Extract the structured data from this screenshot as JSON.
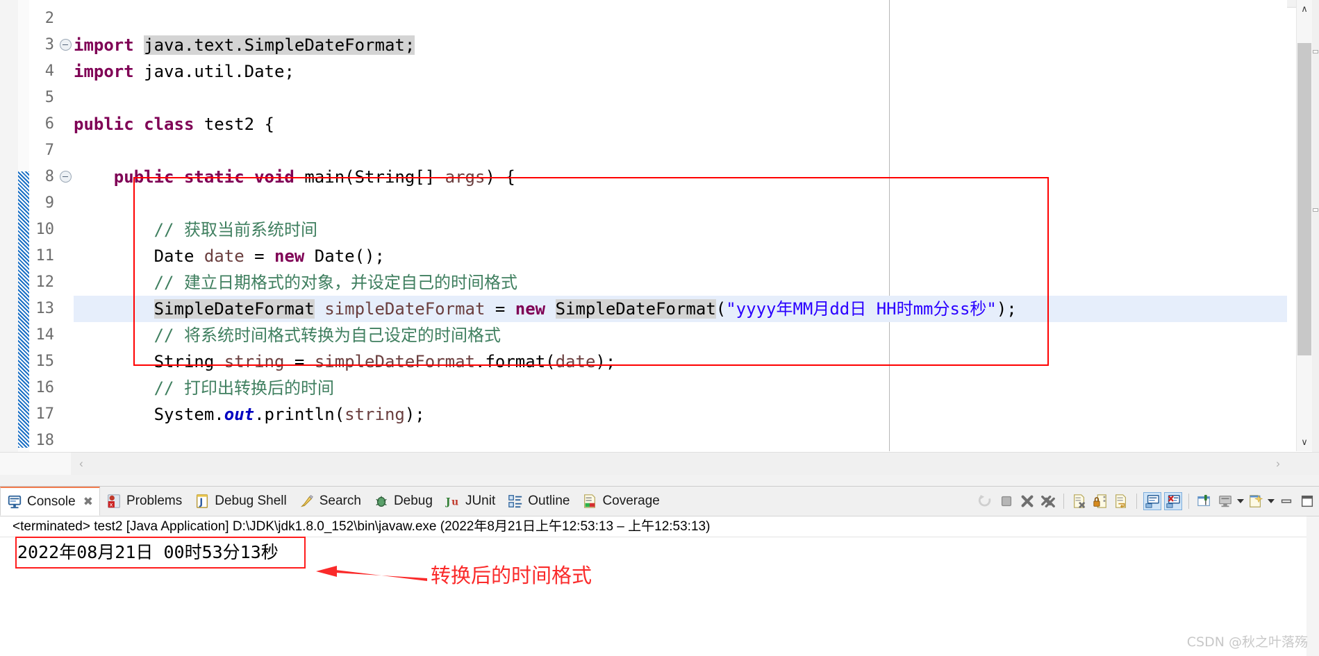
{
  "editor": {
    "first_line_number": 2,
    "lines": [
      {
        "num": "2",
        "fold": false,
        "highlight": false,
        "tokens": []
      },
      {
        "num": "3",
        "fold": true,
        "highlight": false,
        "tokens": [
          {
            "t": "import ",
            "c": "kw"
          },
          {
            "t": "java.text.SimpleDateFormat;",
            "c": "plain occ"
          }
        ]
      },
      {
        "num": "4",
        "fold": false,
        "highlight": false,
        "tokens": [
          {
            "t": "import ",
            "c": "kw"
          },
          {
            "t": "java.util.Date;",
            "c": "plain"
          }
        ]
      },
      {
        "num": "5",
        "fold": false,
        "highlight": false,
        "tokens": []
      },
      {
        "num": "6",
        "fold": false,
        "highlight": false,
        "tokens": [
          {
            "t": "public class ",
            "c": "kw"
          },
          {
            "t": "test2 {",
            "c": "plain"
          }
        ]
      },
      {
        "num": "7",
        "fold": false,
        "highlight": false,
        "tokens": []
      },
      {
        "num": "8",
        "fold": true,
        "highlight": false,
        "tokens": [
          {
            "t": "    ",
            "c": "plain"
          },
          {
            "t": "public static void ",
            "c": "kw"
          },
          {
            "t": "main(String[] ",
            "c": "plain"
          },
          {
            "t": "args",
            "c": "lvar"
          },
          {
            "t": ") {",
            "c": "plain"
          }
        ]
      },
      {
        "num": "9",
        "fold": false,
        "highlight": false,
        "tokens": []
      },
      {
        "num": "10",
        "fold": false,
        "highlight": false,
        "tokens": [
          {
            "t": "        // 获取当前系统时间",
            "c": "cmt"
          }
        ]
      },
      {
        "num": "11",
        "fold": false,
        "highlight": false,
        "tokens": [
          {
            "t": "        Date ",
            "c": "plain"
          },
          {
            "t": "date",
            "c": "lvar"
          },
          {
            "t": " = ",
            "c": "plain"
          },
          {
            "t": "new ",
            "c": "kw"
          },
          {
            "t": "Date();",
            "c": "plain"
          }
        ]
      },
      {
        "num": "12",
        "fold": false,
        "highlight": false,
        "tokens": [
          {
            "t": "        // 建立日期格式的对象，并设定自己的时间格式",
            "c": "cmt"
          }
        ]
      },
      {
        "num": "13",
        "fold": false,
        "highlight": true,
        "tokens": [
          {
            "t": "        ",
            "c": "plain"
          },
          {
            "t": "SimpleDateFormat",
            "c": "plain occ"
          },
          {
            "t": " ",
            "c": "plain"
          },
          {
            "t": "simpleDateFormat",
            "c": "lvar"
          },
          {
            "t": " = ",
            "c": "plain"
          },
          {
            "t": "new ",
            "c": "kw"
          },
          {
            "t": "SimpleDateFormat",
            "c": "plain occ"
          },
          {
            "t": "(",
            "c": "plain"
          },
          {
            "t": "\"yyyy年MM月dd日 HH时mm分ss秒\"",
            "c": "str"
          },
          {
            "t": ");",
            "c": "plain"
          }
        ]
      },
      {
        "num": "14",
        "fold": false,
        "highlight": false,
        "tokens": [
          {
            "t": "        // 将系统时间格式转换为自己设定的时间格式",
            "c": "cmt"
          }
        ]
      },
      {
        "num": "15",
        "fold": false,
        "highlight": false,
        "tokens": [
          {
            "t": "        String ",
            "c": "plain"
          },
          {
            "t": "string",
            "c": "lvar"
          },
          {
            "t": " = ",
            "c": "plain"
          },
          {
            "t": "simpleDateFormat",
            "c": "lvar"
          },
          {
            "t": ".format(",
            "c": "plain"
          },
          {
            "t": "date",
            "c": "lvar"
          },
          {
            "t": ");",
            "c": "plain"
          }
        ]
      },
      {
        "num": "16",
        "fold": false,
        "highlight": false,
        "tokens": [
          {
            "t": "        // 打印出转换后的时间",
            "c": "cmt"
          }
        ]
      },
      {
        "num": "17",
        "fold": false,
        "highlight": false,
        "tokens": [
          {
            "t": "        System.",
            "c": "plain"
          },
          {
            "t": "out",
            "c": "fld"
          },
          {
            "t": ".println(",
            "c": "plain"
          },
          {
            "t": "string",
            "c": "lvar"
          },
          {
            "t": ");",
            "c": "plain"
          }
        ]
      },
      {
        "num": "18",
        "fold": false,
        "highlight": false,
        "tokens": []
      }
    ],
    "scroll_left_label": "‹",
    "scroll_right_label": "›",
    "scroll_up_label": "∧",
    "scroll_down_label": "∨"
  },
  "colors": {
    "keyword": "#7f0055",
    "comment": "#3f7f5f",
    "string": "#2a00ff",
    "field": "#0000c0",
    "local_var": "#6a3e3e",
    "annotation_red": "#fa2a2a",
    "box_red": "#ff0000",
    "selection_row": "#e6eefb",
    "occurrence": "#d4d4d4",
    "change_bar_blue": "#1a6fc4",
    "tab_active_top": "#f27c4e"
  },
  "bottom_panel": {
    "tabs": [
      {
        "label": "Console",
        "icon": "console-icon",
        "active": true,
        "closeable": true
      },
      {
        "label": "Problems",
        "icon": "problems-icon",
        "active": false,
        "closeable": false
      },
      {
        "label": "Debug Shell",
        "icon": "debug-shell-icon",
        "active": false,
        "closeable": false
      },
      {
        "label": "Search",
        "icon": "search-icon",
        "active": false,
        "closeable": false
      },
      {
        "label": "Debug",
        "icon": "debug-bug-icon",
        "active": false,
        "closeable": false
      },
      {
        "label": "JUnit",
        "icon": "junit-icon",
        "active": false,
        "closeable": false
      },
      {
        "label": "Outline",
        "icon": "outline-icon",
        "active": false,
        "closeable": false
      },
      {
        "label": "Coverage",
        "icon": "coverage-icon",
        "active": false,
        "closeable": false
      }
    ],
    "close_glyph": "✖",
    "toolbar": [
      {
        "name": "terminate-relaunch-icon",
        "pressed": false
      },
      {
        "name": "terminate-icon",
        "pressed": false
      },
      {
        "name": "remove-launch-icon",
        "pressed": false
      },
      {
        "name": "remove-all-launches-icon",
        "pressed": false
      },
      {
        "name": "clear-console-icon",
        "pressed": false
      },
      {
        "name": "scroll-lock-icon",
        "pressed": false
      },
      {
        "name": "word-wrap-icon",
        "pressed": false
      },
      {
        "name": "show-console-stdout-icon",
        "pressed": true
      },
      {
        "name": "show-console-stderr-icon",
        "pressed": true
      },
      {
        "name": "pin-console-icon",
        "pressed": false
      },
      {
        "name": "display-selected-console-icon",
        "pressed": false
      },
      {
        "name": "display-console-dropdown-icon",
        "pressed": false
      },
      {
        "name": "open-console-icon",
        "pressed": false
      },
      {
        "name": "open-console-dropdown-icon",
        "pressed": false
      },
      {
        "name": "minimize-view-icon",
        "pressed": false
      },
      {
        "name": "maximize-view-icon",
        "pressed": false
      }
    ],
    "console": {
      "header": "<terminated> test2 [Java Application] D:\\JDK\\jdk1.8.0_152\\bin\\javaw.exe  (2022年8月21日上午12:53:13 – 上午12:53:13)",
      "output": "2022年08月21日  00时53分13秒"
    }
  },
  "annotation": {
    "text": "转换后的时间格式"
  },
  "watermark": {
    "text": "CSDN @秋之叶落殇"
  }
}
